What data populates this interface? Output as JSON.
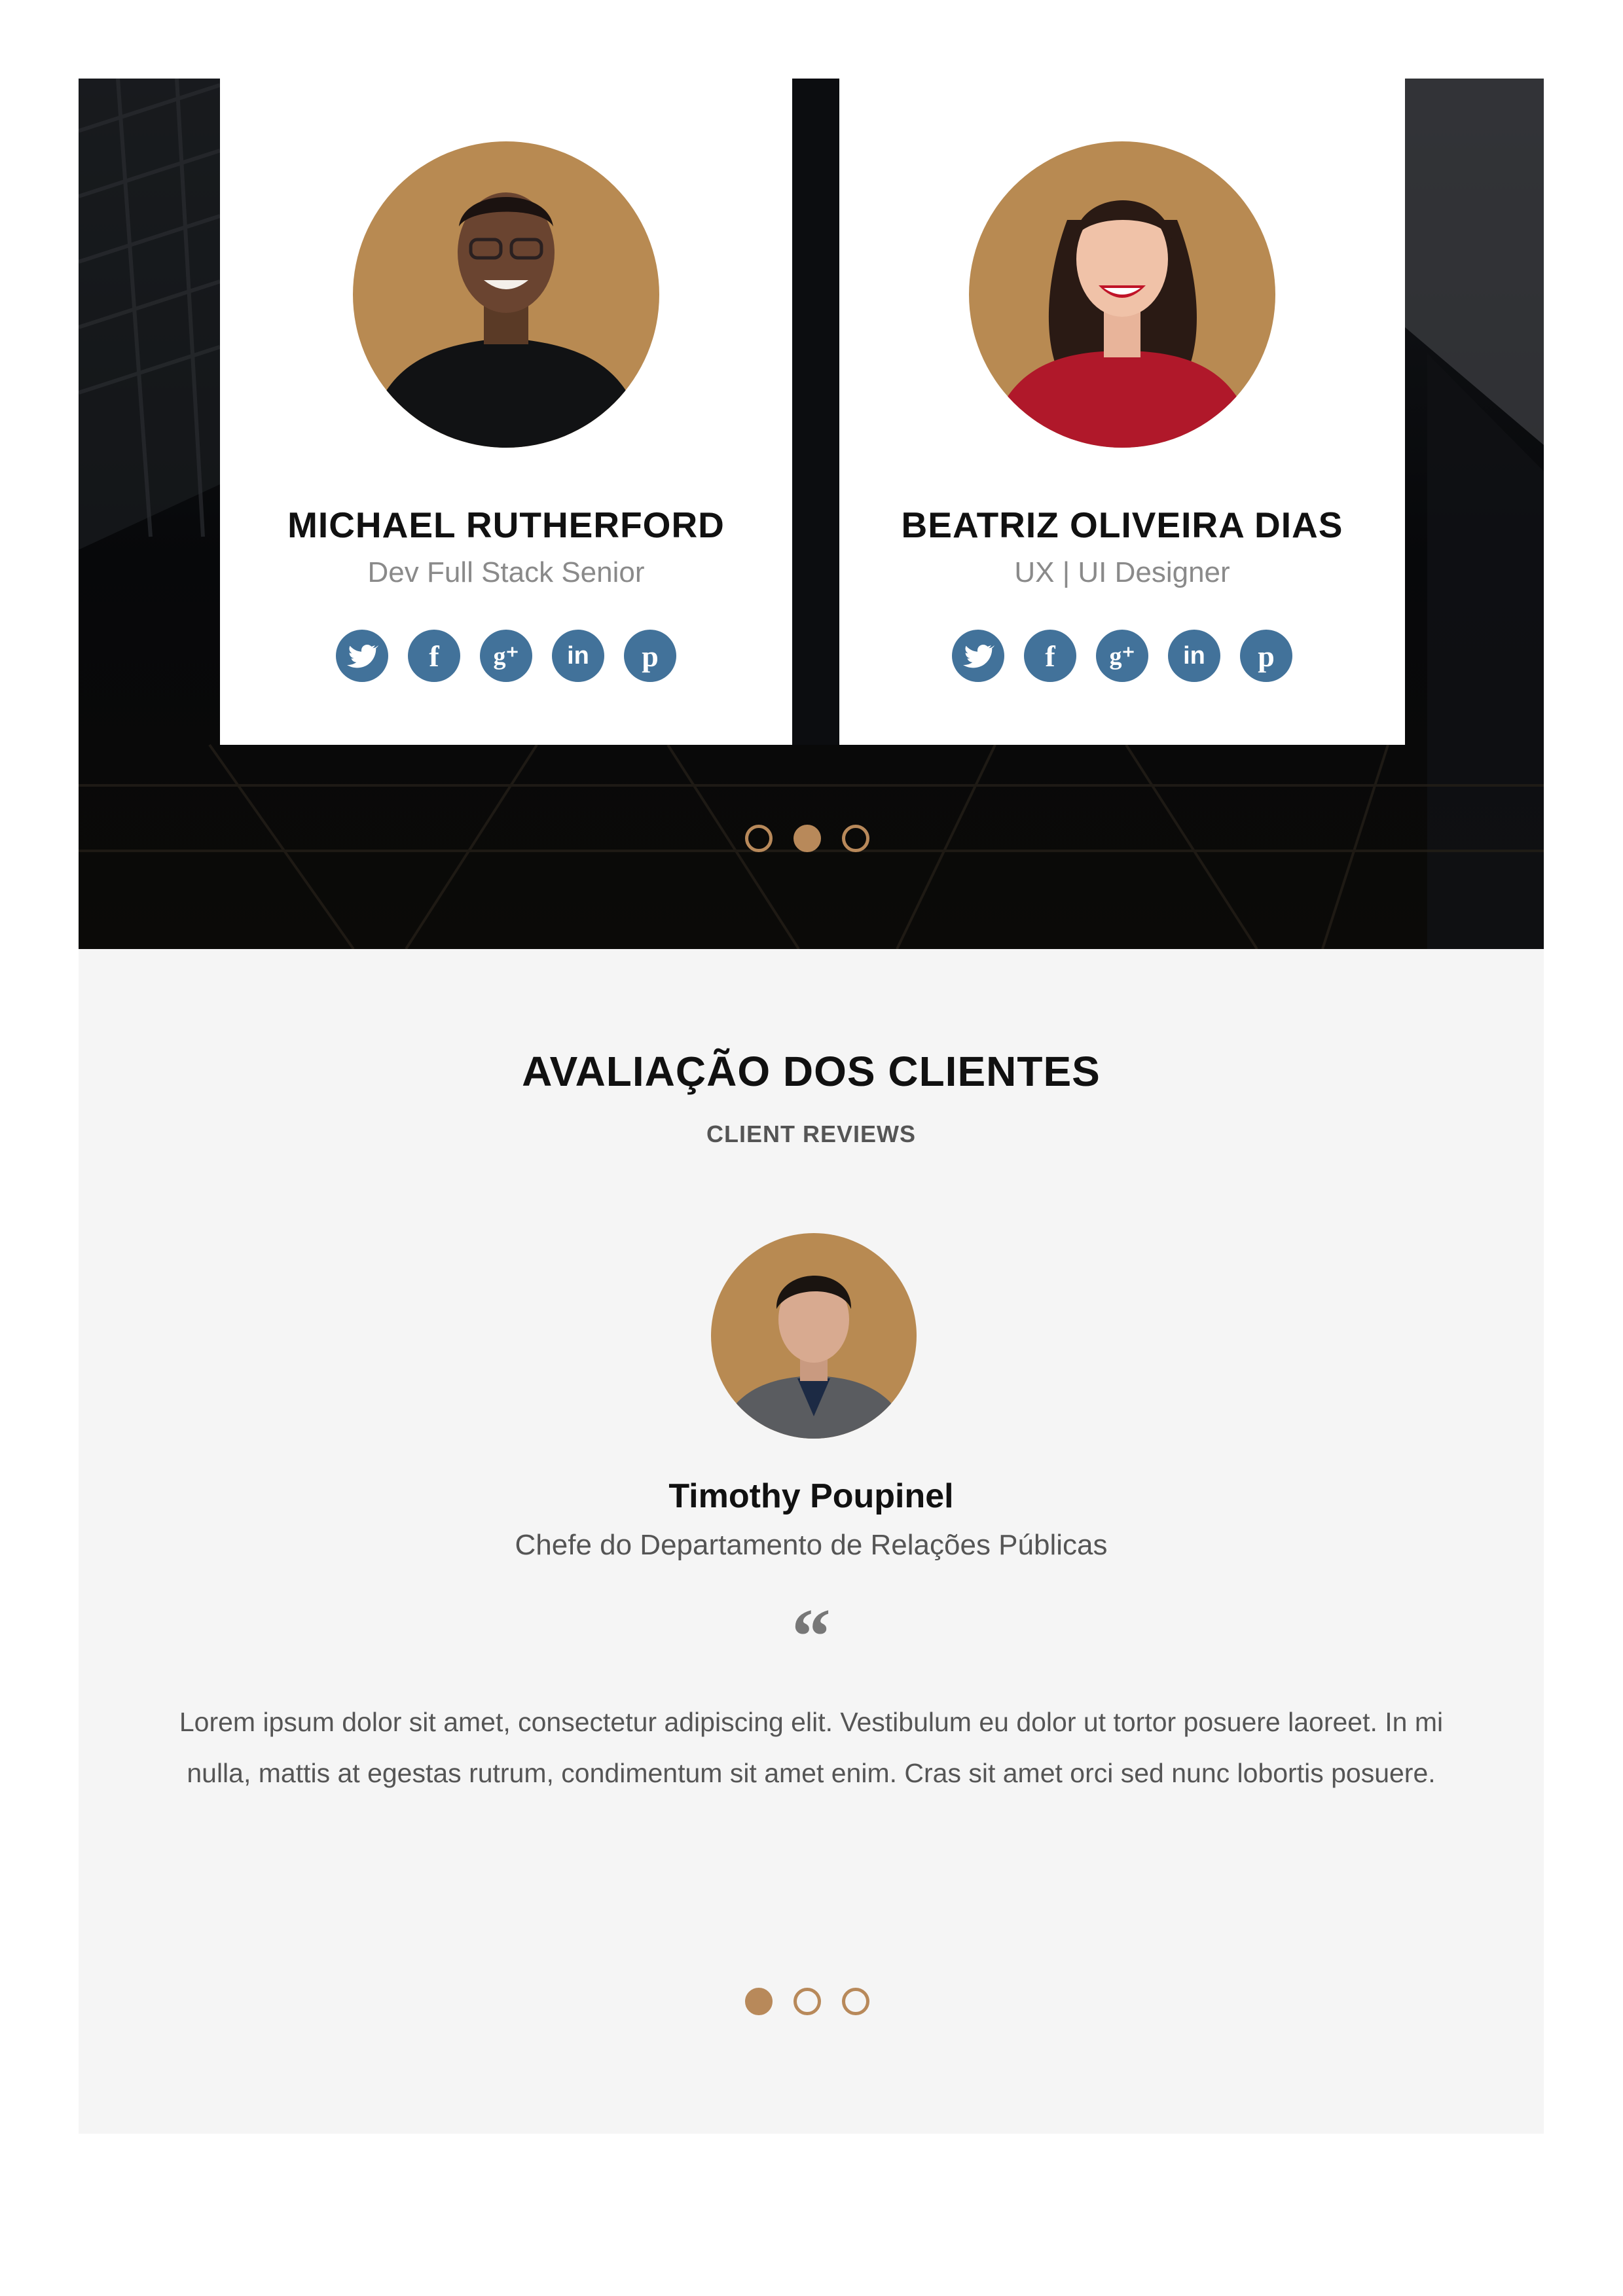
{
  "team": {
    "members": [
      {
        "name": "MICHAEL RUTHERFORD",
        "role": "Dev Full Stack Senior"
      },
      {
        "name": "BEATRIZ OLIVEIRA DIAS",
        "role": "UX | UI Designer"
      }
    ],
    "social_icons": [
      "twitter-icon",
      "facebook-icon",
      "google-plus-icon",
      "linkedin-icon",
      "pinterest-icon"
    ],
    "pagination": {
      "count": 3,
      "active_index": 1
    }
  },
  "reviews": {
    "title": "AVALIAÇÃO DOS CLIENTES",
    "subtitle": "CLIENT REVIEWS",
    "client": {
      "name": "Timothy Poupinel",
      "role": "Chefe do Departamento de Relações Públicas",
      "quote": "Lorem ipsum dolor sit amet, consectetur adipiscing elit. Vestibulum eu dolor ut tortor posuere laoreet. In mi nulla, mattis at egestas rutrum, condimentum sit amet enim. Cras sit amet orci sed nunc lobortis posuere."
    },
    "pagination": {
      "count": 3,
      "active_index": 0
    }
  },
  "colors": {
    "accent": "#b8895a",
    "social": "#42729a",
    "team_background": "#050607",
    "reviews_background": "#f5f5f5"
  }
}
